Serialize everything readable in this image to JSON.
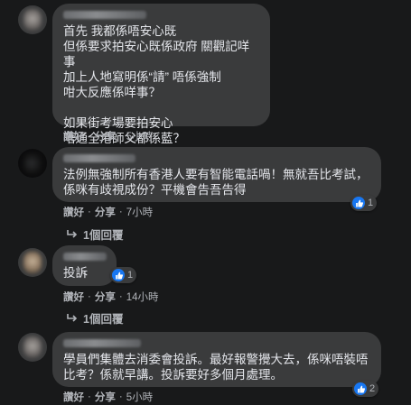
{
  "comments": [
    {
      "lines": [
        "首先 我都係唔安心既",
        "但係要求拍安心既係政府 關觀記咩事",
        "加上人地寫明係“請” 唔係強制",
        "咁大反應係咩事？",
        "",
        "如果街考場要拍安心",
        "唔通全港師父都係藍？"
      ],
      "like": "讚好",
      "reply": "分享",
      "time": "5小時"
    },
    {
      "lines": [
        "法例無強制所有香港人要有智能電話喎！無就吾比考試，",
        "係咪有歧視成份？平機會告吾告得"
      ],
      "like": "讚好",
      "reply": "分享",
      "time": "7小時",
      "reactions": "1",
      "replies": "1個回覆"
    },
    {
      "lines": [
        "投訴"
      ],
      "like": "讚好",
      "reply": "分享",
      "time": "14小時",
      "reactions": "1",
      "replies": "1個回覆"
    },
    {
      "lines": [
        "學員們集體去消委會投訴。最好報警攪大去，係咪唔裝唔",
        "比考？係就早講。投訴要好多個月處理。"
      ],
      "like": "讚好",
      "reply": "分享",
      "time": "5小時",
      "reactions": "2"
    }
  ],
  "separator": "·",
  "colors": {
    "background": "#18191a",
    "bubble": "#3a3b3c",
    "text": "#e4e6eb",
    "meta": "#b0b3b8",
    "like": "#1877f2"
  }
}
